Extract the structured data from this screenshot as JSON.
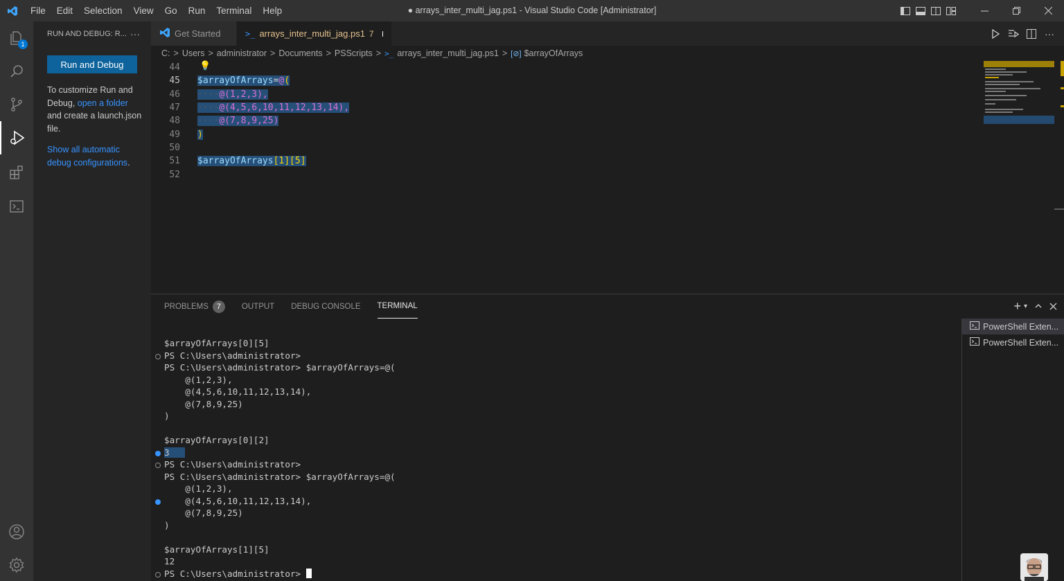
{
  "window": {
    "title": "● arrays_inter_multi_jag.ps1 - Visual Studio Code [Administrator]",
    "menu": [
      "File",
      "Edit",
      "Selection",
      "View",
      "Go",
      "Run",
      "Terminal",
      "Help"
    ]
  },
  "activity": {
    "explorer_badge": "1"
  },
  "sidebar": {
    "header": "RUN AND DEBUG: R...",
    "more": "···",
    "run_button": "Run and Debug",
    "text_1": "To customize Run and Debug,",
    "link_1": "open a folder",
    "text_2": "and create a launch.json file.",
    "link_2": "Show all automatic debug configurations",
    "link_2_end": "."
  },
  "tabs": [
    {
      "label": "Get Started"
    },
    {
      "label": "arrays_inter_multi_jag.ps1",
      "count": "7"
    }
  ],
  "breadcrumb": [
    "C:",
    "Users",
    "administrator",
    "Documents",
    "PSScripts",
    "arrays_inter_multi_jag.ps1",
    "$arrayOfArrays"
  ],
  "editor": {
    "line_numbers": [
      "44",
      "45",
      "46",
      "47",
      "48",
      "49",
      "50",
      "51",
      "52"
    ],
    "lines": {
      "l45_var": "$arrayOfArrays",
      "l45_rest": "=",
      "l45_at": "@",
      "l45_paren": "(",
      "l46": "@(1,2,3),",
      "l47": "@(4,5,6,10,11,12,13,14),",
      "l48": "@(7,8,9,25)",
      "l49": ")",
      "l51_var": "$arrayOfArrays",
      "l51_rest": "[1][5]"
    }
  },
  "panel": {
    "tabs": [
      "PROBLEMS",
      "OUTPUT",
      "DEBUG CONSOLE",
      "TERMINAL"
    ],
    "problems_count": "7",
    "terminal_lines": [
      "$arrayOfArrays[0][5]",
      "PS C:\\Users\\administrator>",
      "PS C:\\Users\\administrator> $arrayOfArrays=@(",
      "    @(1,2,3),",
      "    @(4,5,6,10,11,12,13,14),",
      "    @(7,8,9,25)",
      ")",
      "",
      "$arrayOfArrays[0][2]",
      "3",
      "PS C:\\Users\\administrator>",
      "PS C:\\Users\\administrator> $arrayOfArrays=@(",
      "    @(1,2,3),",
      "    @(4,5,6,10,11,12,13,14),",
      "    @(7,8,9,25)",
      ")",
      "",
      "$arrayOfArrays[1][5]",
      "12",
      "PS C:\\Users\\administrator> "
    ],
    "terminal_instances": [
      "PowerShell Exten...",
      "PowerShell Exten..."
    ]
  },
  "colors": {
    "accent": "#0e639c",
    "link": "#3794ff",
    "modified_tab": "#e2c08d"
  }
}
